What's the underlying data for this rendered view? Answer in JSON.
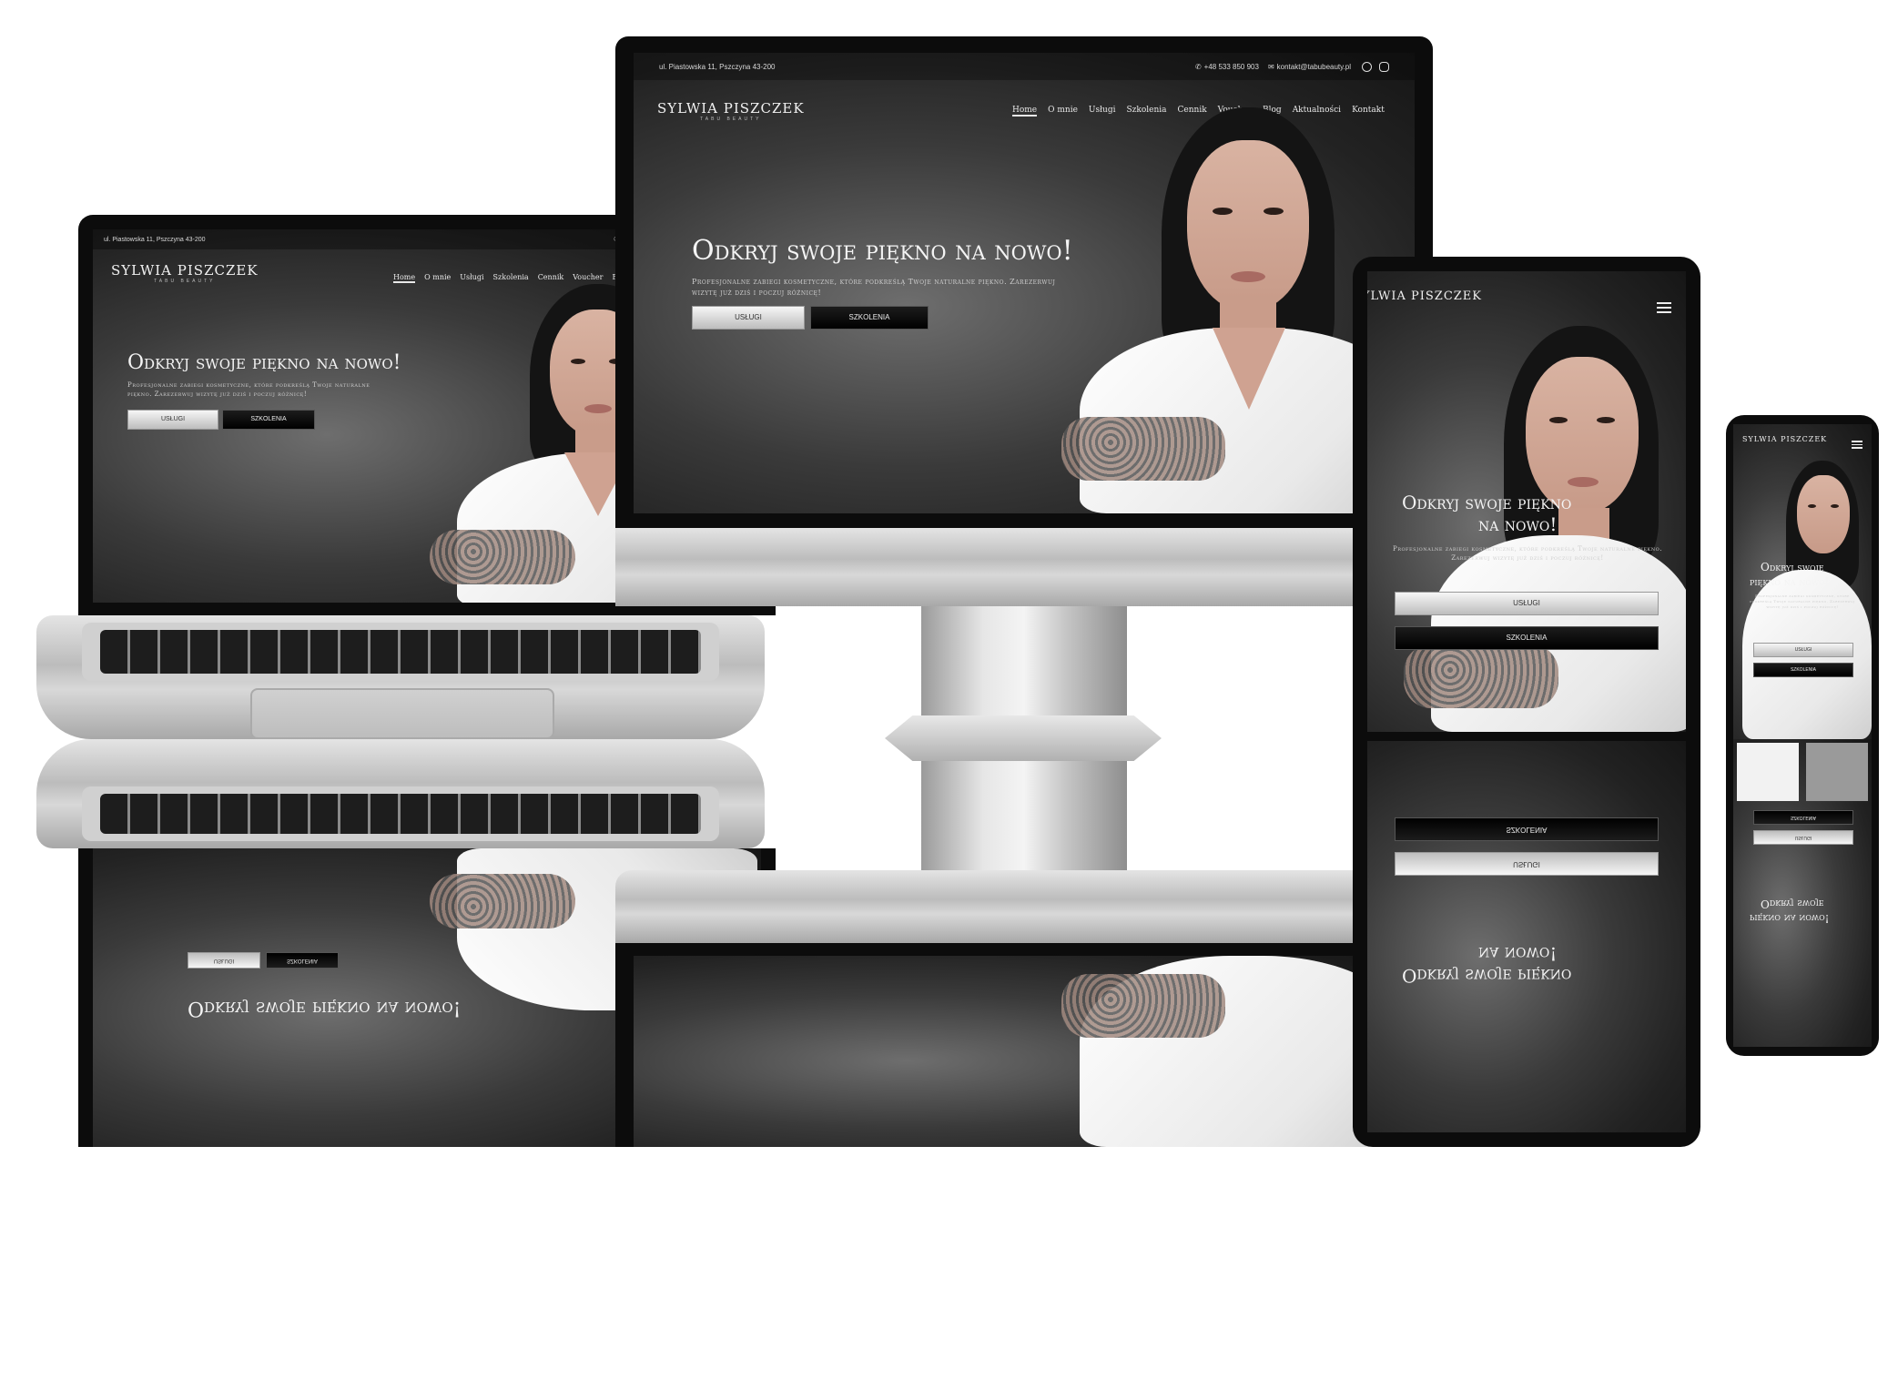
{
  "site": {
    "address": "ul. Piastowska 11, Pszczyna 43-200",
    "phone": "+48 533 850 903",
    "email": "kontakt@tabubeauty.pl",
    "logo_name": "SYLWIA PISZCZEK",
    "logo_sub": "TABU BEAUTY",
    "nav": [
      "Home",
      "O mnie",
      "Usługi",
      "Szkolenia",
      "Cennik",
      "Voucher",
      "Blog",
      "Aktualności",
      "Kontakt"
    ],
    "hero_title": "Odkryj swoje piękno na nowo!",
    "hero_title_tablet_1": "Odkryj swoje piękno",
    "hero_title_tablet_2": "na nowo!",
    "hero_title_phone_1": "Odkryj swoje",
    "hero_title_phone_2": "piękno na nowo!",
    "hero_subtitle": "Profesjonalne zabiegi kosmetyczne, które podkreślą Twoje naturalne piękno. Zarezerwuj wizytę już dziś i poczuj różnicę!",
    "btn_services": "USŁUGI",
    "btn_training": "SZKOLENIA"
  },
  "colors": {
    "background": "#ffffff",
    "screen_dark": "#1e1e1e",
    "accent_text": "#f2f2f2",
    "device_silver": "#c8c8c8"
  },
  "icons": [
    "phone-icon",
    "mail-icon",
    "facebook-icon",
    "instagram-icon",
    "hamburger-menu-icon"
  ]
}
